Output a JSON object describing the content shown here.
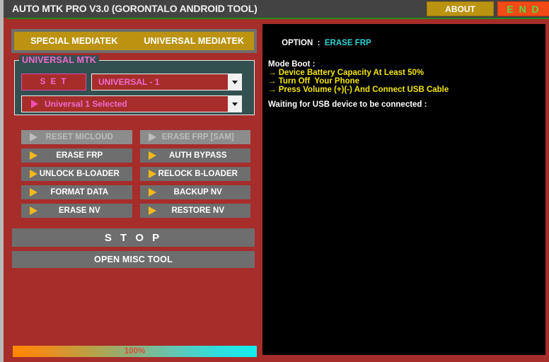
{
  "titlebar": {
    "title": "AUTO MTK PRO V3.0 (GORONTALO ANDROID TOOL)",
    "about_label": "ABOUT",
    "end_label": "E N D"
  },
  "tabs": [
    {
      "label": "SPECIAL MEDIATEK"
    },
    {
      "label": "UNIVERSAL MEDIATEK"
    }
  ],
  "group": {
    "label": "UNIVERSAL MTK",
    "set_button": "S E T",
    "combo_model": "UNIVERSAL - 1",
    "combo_status": "Universal 1 Selected"
  },
  "actions": [
    {
      "label": "RESET MICLOUD",
      "enabled": false
    },
    {
      "label": "ERASE FRP [SAM]",
      "enabled": false
    },
    {
      "label": "ERASE FRP",
      "enabled": true
    },
    {
      "label": "AUTH BYPASS",
      "enabled": true
    },
    {
      "label": "UNLOCK B-LOADER",
      "enabled": true
    },
    {
      "label": "RELOCK B-LOADER",
      "enabled": true
    },
    {
      "label": "FORMAT DATA",
      "enabled": true
    },
    {
      "label": "BACKUP NV",
      "enabled": true
    },
    {
      "label": "ERASE NV",
      "enabled": true
    },
    {
      "label": "RESTORE NV",
      "enabled": true
    }
  ],
  "stop_button": "S T O P",
  "misc_button": "OPEN MISC TOOL",
  "progress": {
    "percent_label": "100%",
    "value": 100
  },
  "console": {
    "option_key": "OPTION  :",
    "option_value": "ERASE FRP",
    "mode_boot_header": "Mode Boot :",
    "steps": [
      "→ Device Battery Capacity At Least 50%",
      "→ Turn Off  Your Phone",
      "→ Press Volume (+)(-) And Connect USB Cable"
    ],
    "status": "Waiting for USB device to be connected :"
  },
  "colors": {
    "body_red": "#a62d2a",
    "titlebar": "#434343",
    "gold": "#bc9311",
    "end_orange": "#f44a16",
    "end_green": "#4fe049",
    "group_teal": "#335050",
    "pink": "#ef6bd0",
    "button_gray": "#6e6e6e",
    "arrow_yellow": "#f5b81b",
    "console_bg": "#000000",
    "console_cyan": "#2fd3d3",
    "console_yellow": "#f5e50a"
  }
}
